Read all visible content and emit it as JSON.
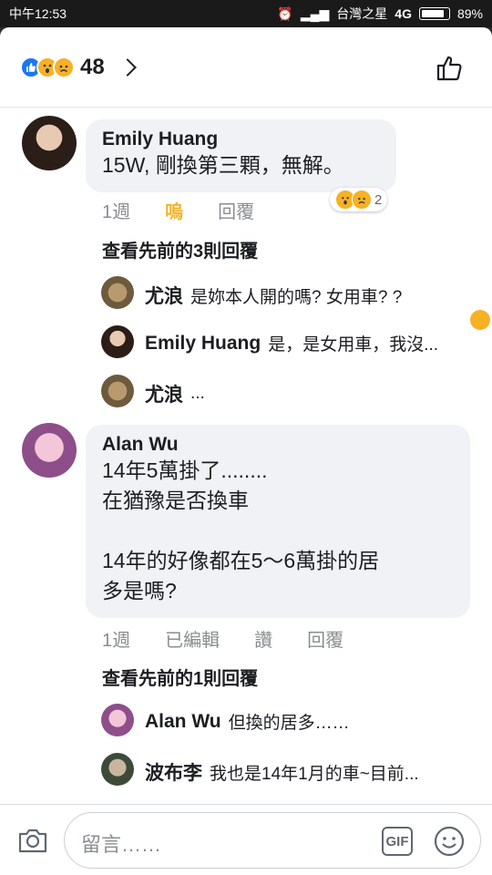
{
  "status_bar": {
    "time": "中午12:53",
    "carrier": "台灣之星",
    "network": "4G",
    "battery": "89%",
    "battery_level": 0.89
  },
  "reactions": {
    "count": "48",
    "icons": [
      "like-icon",
      "wow-icon",
      "sad-icon"
    ]
  },
  "comments": [
    {
      "author": "Emily Huang",
      "text": "15W, 剛換第三顆，無解。",
      "time": "1週",
      "actions": [
        "嗚",
        "回覆"
      ],
      "reaction_count": "2",
      "view_previous": "查看先前的3則回覆",
      "replies": [
        {
          "author": "尤浪",
          "text": "是妳本人開的嗎? 女用車? ?"
        },
        {
          "author": "Emily Huang",
          "text": "是，是女用車，我沒..."
        },
        {
          "author": "尤浪",
          "text": "..."
        }
      ]
    },
    {
      "author": "Alan Wu",
      "text": "14年5萬掛了........\n在猶豫是否換車\n\n14年的好像都在5～6萬掛的居\n多是嗎?",
      "time": "1週",
      "actions": [
        "已編輯",
        "讚",
        "回覆"
      ],
      "view_previous": "查看先前的1則回覆",
      "replies": [
        {
          "author": "Alan Wu",
          "text": "但換的居多……"
        },
        {
          "author": "波布李",
          "text": "我也是14年1月的車~目前..."
        }
      ]
    }
  ],
  "composer": {
    "placeholder": "留言……",
    "gif_label": "GIF"
  },
  "colors": {
    "like_blue": "#1877f2",
    "reaction_yellow": "#f7b125",
    "cry_label": "#f0b429",
    "bubble_bg": "#f0f2f5"
  }
}
